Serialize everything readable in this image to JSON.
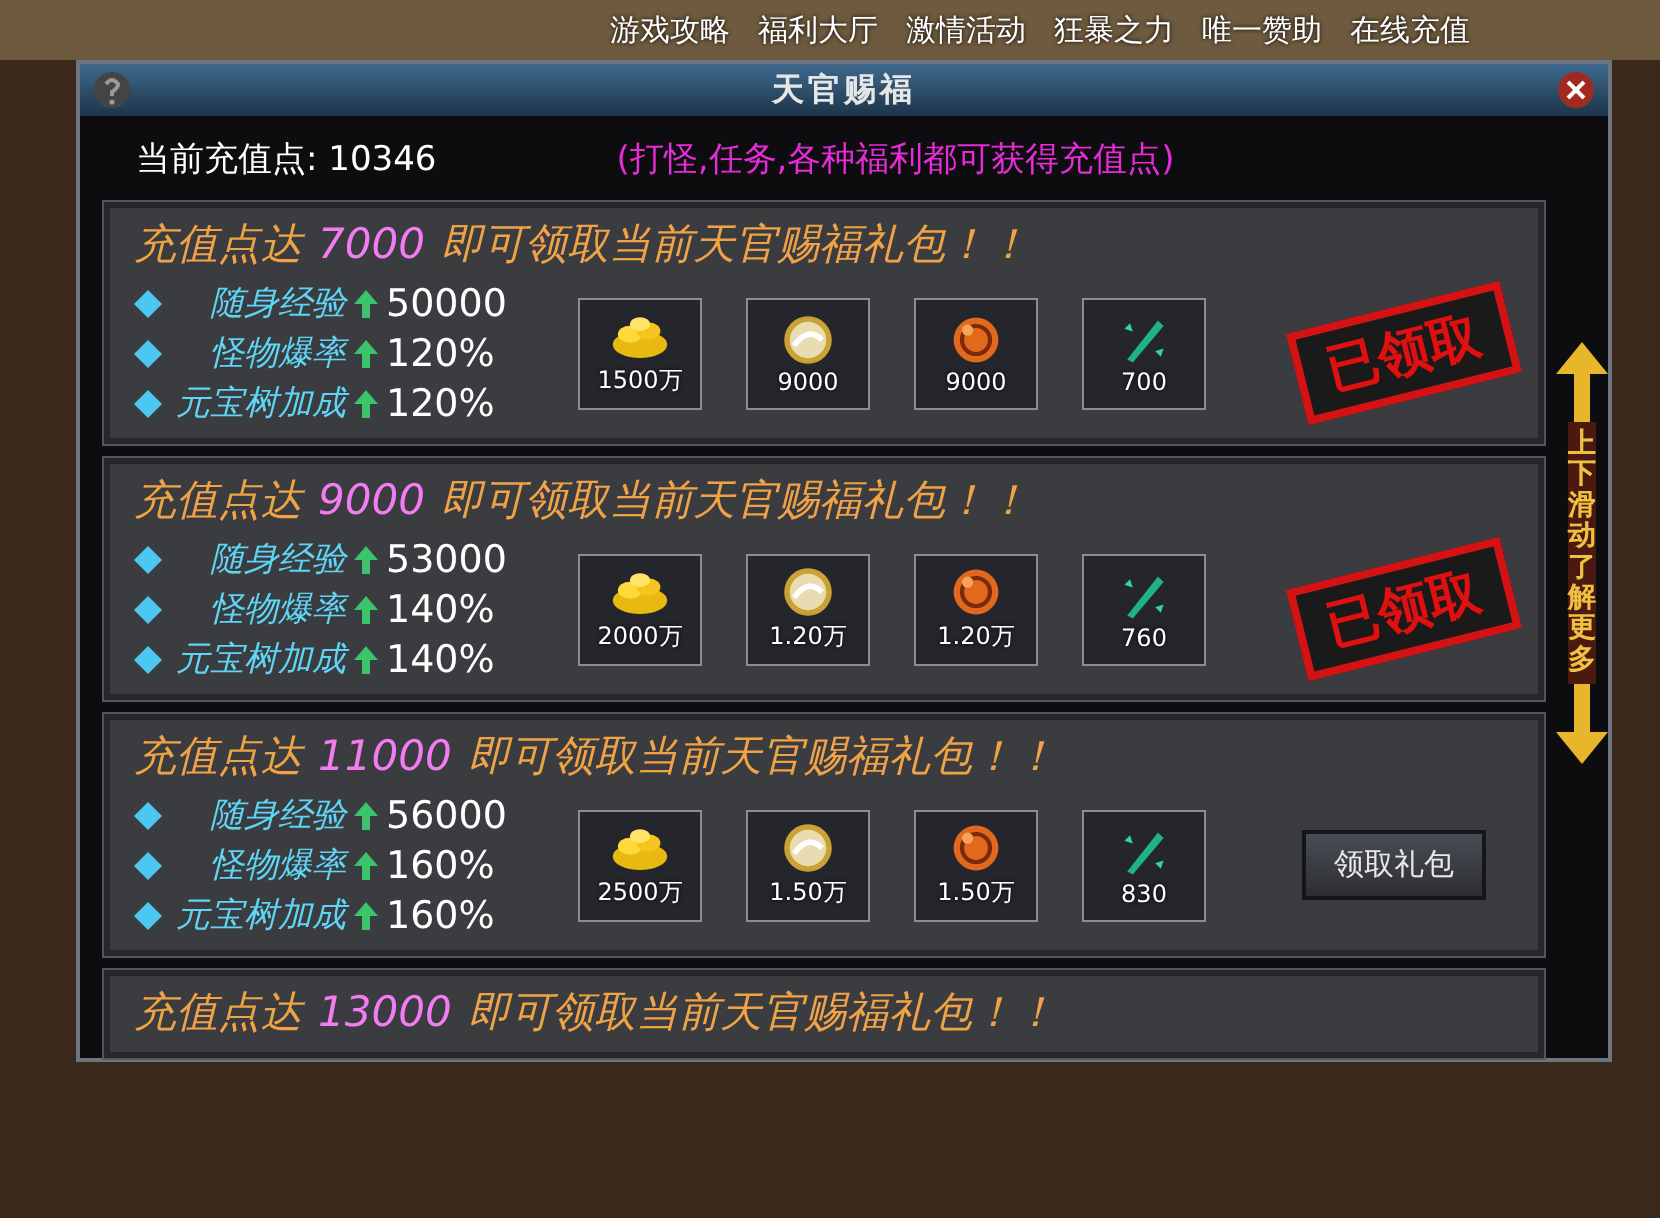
{
  "top_menu": [
    "游戏攻略",
    "福利大厅",
    "激情活动",
    "狂暴之力",
    "唯一赞助",
    "在线充值"
  ],
  "dialog": {
    "title": "天官赐福",
    "points_label": "当前充值点:",
    "points_value": "10346",
    "hint": "(打怪,任务,各种福利都可获得充值点)"
  },
  "tiers": [
    {
      "prefix": "充值点达",
      "threshold": "7000",
      "suffix": "即可领取当前天官赐福礼包！！",
      "claimed": true,
      "action": "已领取",
      "stats": [
        {
          "label": "随身经验",
          "value": "50000"
        },
        {
          "label": "怪物爆率",
          "value": "120%"
        },
        {
          "label": "元宝树加成",
          "value": "120%"
        }
      ],
      "rewards": [
        {
          "kind": "gold",
          "amount": "1500万"
        },
        {
          "kind": "pearl",
          "amount": "9000"
        },
        {
          "kind": "fire",
          "amount": "9000"
        },
        {
          "kind": "crystal",
          "amount": "700"
        }
      ]
    },
    {
      "prefix": "充值点达",
      "threshold": "9000",
      "suffix": "即可领取当前天官赐福礼包！！",
      "claimed": true,
      "action": "已领取",
      "stats": [
        {
          "label": "随身经验",
          "value": "53000"
        },
        {
          "label": "怪物爆率",
          "value": "140%"
        },
        {
          "label": "元宝树加成",
          "value": "140%"
        }
      ],
      "rewards": [
        {
          "kind": "gold",
          "amount": "2000万"
        },
        {
          "kind": "pearl",
          "amount": "1.20万"
        },
        {
          "kind": "fire",
          "amount": "1.20万"
        },
        {
          "kind": "crystal",
          "amount": "760"
        }
      ]
    },
    {
      "prefix": "充值点达",
      "threshold": "11000",
      "suffix": "即可领取当前天官赐福礼包！！",
      "claimed": false,
      "action": "领取礼包",
      "stats": [
        {
          "label": "随身经验",
          "value": "56000"
        },
        {
          "label": "怪物爆率",
          "value": "160%"
        },
        {
          "label": "元宝树加成",
          "value": "160%"
        }
      ],
      "rewards": [
        {
          "kind": "gold",
          "amount": "2500万"
        },
        {
          "kind": "pearl",
          "amount": "1.50万"
        },
        {
          "kind": "fire",
          "amount": "1.50万"
        },
        {
          "kind": "crystal",
          "amount": "830"
        }
      ]
    },
    {
      "prefix": "充值点达",
      "threshold": "13000",
      "suffix": "即可领取当前天官赐福礼包！！"
    }
  ],
  "scroll_hint": "上下滑动了解更多"
}
